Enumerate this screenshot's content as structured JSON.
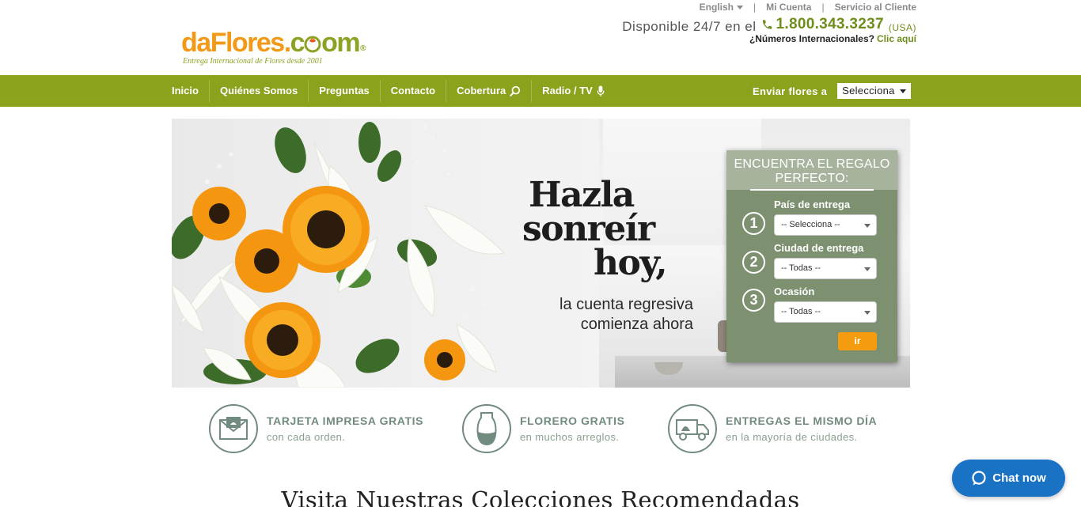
{
  "brand": {
    "logo_da": "da",
    "logo_flores": "Flores.",
    "logo_com": "c",
    "logo_om": "om",
    "logo_reg": "®",
    "tagline": "Entrega Internacional de Flores desde 2001",
    "colors": {
      "orange": "#f29a18",
      "green": "#8aa323"
    }
  },
  "toplinks": {
    "language": "English",
    "account": "Mi Cuenta",
    "service": "Servicio al Cliente"
  },
  "contact": {
    "available": "Disponible 24/7 en el",
    "phone": "1.800.343.3237",
    "country": "(USA)",
    "intl_question": "¿Números Internacionales?",
    "intl_link": "Clic aquí"
  },
  "nav": {
    "items": [
      {
        "label": "Inicio",
        "icon": ""
      },
      {
        "label": "Quiénes Somos",
        "icon": ""
      },
      {
        "label": "Preguntas",
        "icon": ""
      },
      {
        "label": "Contacto",
        "icon": ""
      },
      {
        "label": "Cobertura",
        "icon": "search-icon"
      },
      {
        "label": "Radio / TV",
        "icon": "microphone-icon"
      }
    ],
    "send_to_label": "Enviar flores a",
    "send_to_value": "Selecciona",
    "color": "#8aa21c"
  },
  "hero": {
    "line1": "Hazla",
    "line2": "sonreír",
    "line3": "hoy,",
    "sub1": "la cuenta regresiva",
    "sub2": "comienza ahora"
  },
  "finder": {
    "title": "ENCUENTRA EL REGALO PERFECTO:",
    "steps": [
      {
        "number": "1",
        "label": "País de entrega",
        "value": "-- Selecciona --"
      },
      {
        "number": "2",
        "label": "Ciudad de entrega",
        "value": "-- Todas --"
      },
      {
        "number": "3",
        "label": "Ocasión",
        "value": "-- Todas --"
      }
    ],
    "go": "ir",
    "colors": {
      "panel": "#7d9170",
      "button": "#f59b10"
    }
  },
  "features": [
    {
      "title": "TARJETA IMPRESA GRATIS",
      "sub": "con cada orden.",
      "icon": "card-envelope-icon"
    },
    {
      "title": "FLORERO GRATIS",
      "sub": "en muchos arreglos.",
      "icon": "vase-icon"
    },
    {
      "title": "ENTREGAS EL MISMO DÍA",
      "sub": "en la mayoría de ciudades.",
      "icon": "delivery-truck-icon"
    }
  ],
  "collections_title": "Visita Nuestras Colecciones Recomendadas",
  "chat": {
    "label": "Chat now",
    "color": "#1a72c4"
  }
}
